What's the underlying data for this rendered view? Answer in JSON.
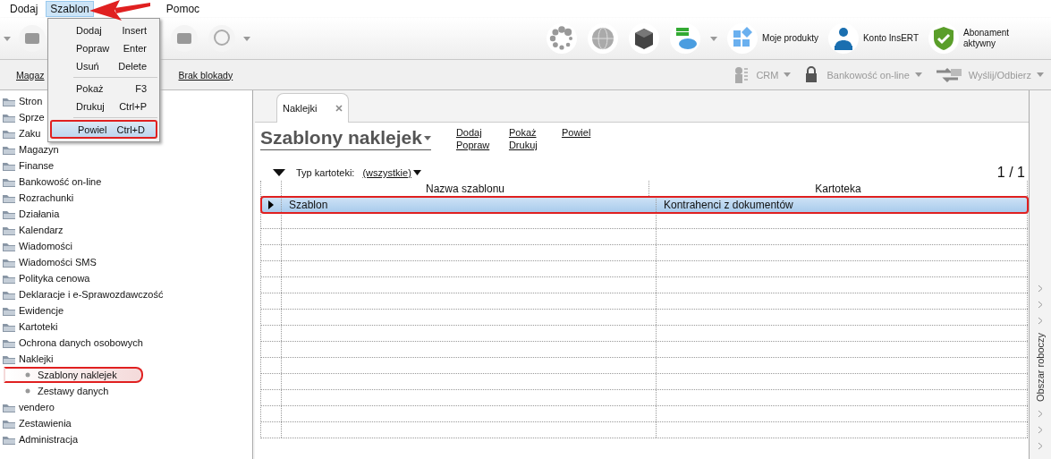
{
  "menu_bar": [
    {
      "label": "Dodaj",
      "selected": false
    },
    {
      "label": "Szablon",
      "selected": true
    },
    {
      "label": "Pomoc",
      "selected": false
    }
  ],
  "dropdown_menu": [
    {
      "label": "Dodaj",
      "shortcut": "Insert",
      "selected": false
    },
    {
      "label": "Popraw",
      "shortcut": "Enter",
      "selected": false
    },
    {
      "label": "Usuń",
      "shortcut": "Delete",
      "selected": false
    },
    {
      "label": "Pokaż",
      "shortcut": "F3",
      "selected": false
    },
    {
      "label": "Drukuj",
      "shortcut": "Ctrl+P",
      "selected": false
    },
    {
      "label": "Powiel",
      "shortcut": "Ctrl+D",
      "selected": true
    }
  ],
  "toolbar_right": [
    {
      "kind": "icon"
    },
    {
      "kind": "icon"
    },
    {
      "kind": "icon"
    },
    {
      "kind": "dropdown"
    },
    {
      "kind": "labeled",
      "label": "Moje produkty"
    },
    {
      "kind": "labeled",
      "label": "Konto InsERT"
    },
    {
      "kind": "labeled",
      "label": "Abonament aktywny"
    }
  ],
  "sub_bar": {
    "links": [
      "Magaz",
      "Brak blokady"
    ],
    "actions": [
      {
        "label": "CRM",
        "disabled": true
      },
      {
        "label": "Bankowość on-line",
        "disabled": true
      },
      {
        "label": "Wyślij/Odbierz",
        "disabled": true
      }
    ]
  },
  "sidebar": {
    "items": [
      {
        "label": "Stron"
      },
      {
        "label": "Sprze"
      },
      {
        "label": "Zaku"
      },
      {
        "label": "Magazyn"
      },
      {
        "label": "Finanse"
      },
      {
        "label": "Bankowość on-line"
      },
      {
        "label": "Rozrachunki"
      },
      {
        "label": "Działania"
      },
      {
        "label": "Kalendarz"
      },
      {
        "label": "Wiadomości"
      },
      {
        "label": "Wiadomości SMS"
      },
      {
        "label": "Polityka cenowa"
      },
      {
        "label": "Deklaracje i e-Sprawozdawczość"
      },
      {
        "label": "Ewidencje"
      },
      {
        "label": "Kartoteki"
      },
      {
        "label": "Ochrona danych osobowych"
      },
      {
        "label": "Naklejki",
        "children": [
          {
            "label": "Szablony naklejek",
            "selected": true
          },
          {
            "label": "Zestawy danych",
            "selected": false
          }
        ]
      },
      {
        "label": "vendero"
      },
      {
        "label": "Zestawienia"
      },
      {
        "label": "Administracja"
      }
    ]
  },
  "tabs": [
    {
      "label": "Naklejki",
      "selected": true
    }
  ],
  "page": {
    "title": "Szablony naklejek",
    "actions": [
      [
        "Dodaj",
        "Popraw"
      ],
      [
        "Pokaż",
        "Drukuj"
      ],
      [
        "Powiel"
      ]
    ],
    "filter_label": "Typ kartoteki:",
    "filter_value": "(wszystkie)",
    "page_count": "1 / 1"
  },
  "table": {
    "columns": [
      "Nazwa szablonu",
      "Kartoteka"
    ],
    "rows": [
      {
        "cells": [
          "Szablon",
          "Kontrahenci z dokumentów"
        ],
        "selected": true
      }
    ]
  },
  "side_panel": {
    "label": "Obszar roboczy"
  }
}
